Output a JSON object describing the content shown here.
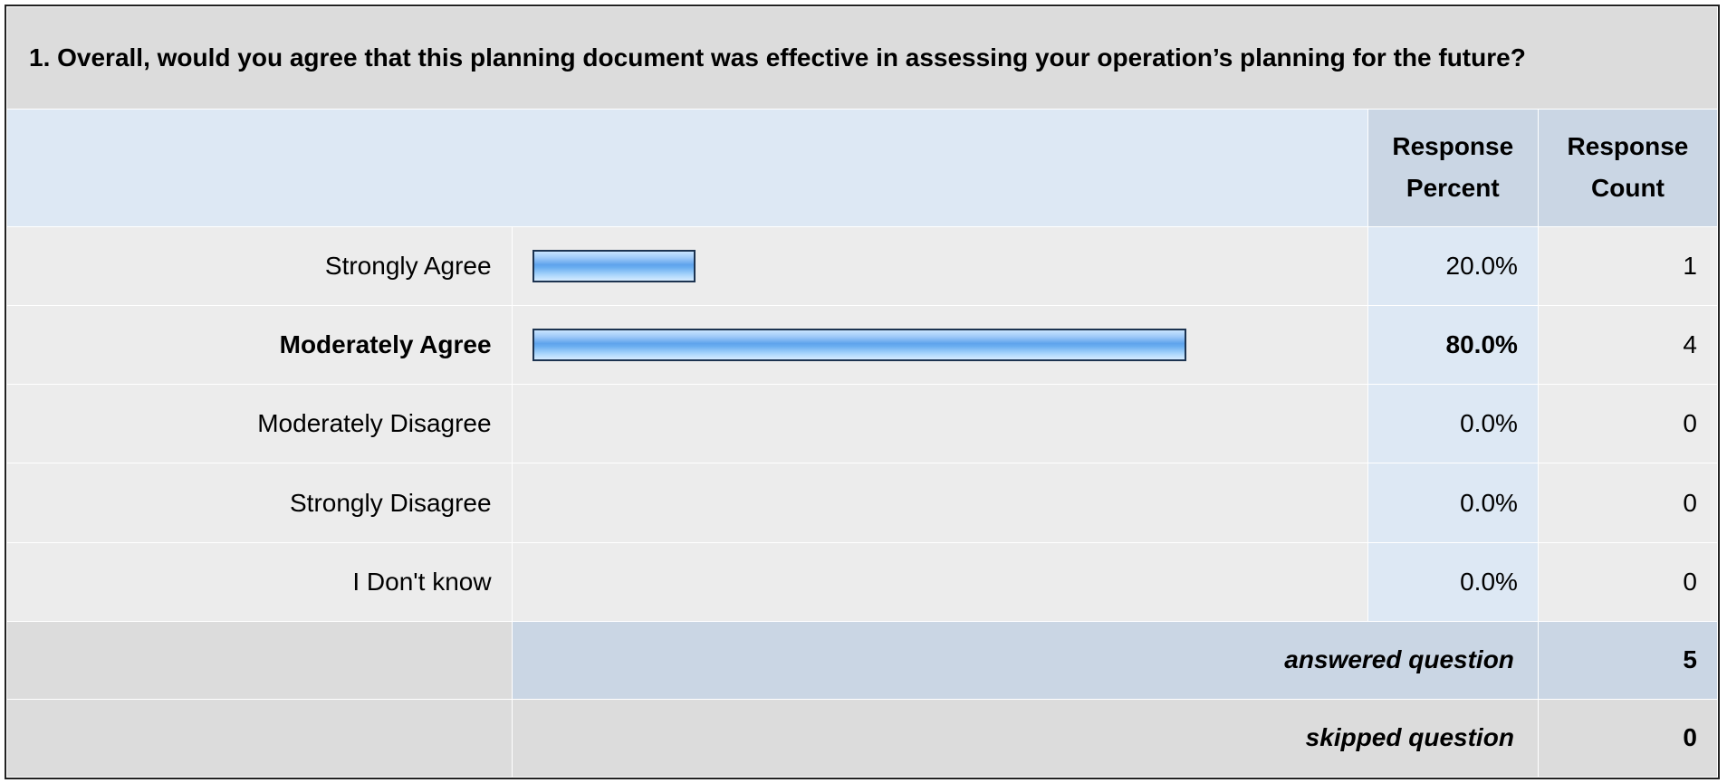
{
  "question": {
    "title": "1. Overall, would you agree that this planning document was effective in assessing your operation’s planning for the future?"
  },
  "headers": {
    "percent_line1": "Response",
    "percent_line2": "Percent",
    "count_line1": "Response",
    "count_line2": "Count"
  },
  "rows": [
    {
      "label": "Strongly Agree",
      "percent": "20.0%",
      "count": "1",
      "bold": false
    },
    {
      "label": "Moderately Agree",
      "percent": "80.0%",
      "count": "4",
      "bold": true
    },
    {
      "label": "Moderately Disagree",
      "percent": "0.0%",
      "count": "0",
      "bold": false
    },
    {
      "label": "Strongly Disagree",
      "percent": "0.0%",
      "count": "0",
      "bold": false
    },
    {
      "label": "I Don't know",
      "percent": "0.0%",
      "count": "0",
      "bold": false
    }
  ],
  "summary": {
    "answered_label": "answered question",
    "answered_value": "5",
    "skipped_label": "skipped question",
    "skipped_value": "0"
  },
  "colors": {
    "bar_fill": "#6aaef0",
    "bar_border": "#1c3350",
    "title_bg": "#dcdcdc",
    "header_bg": "#cad6e4",
    "light_blue_bg": "#dde8f4",
    "row_bg": "#ececec"
  },
  "chart_data": {
    "type": "bar",
    "orientation": "horizontal",
    "categories": [
      "Strongly Agree",
      "Moderately Agree",
      "Moderately Disagree",
      "Strongly Disagree",
      "I Don't know"
    ],
    "values": [
      20.0,
      80.0,
      0.0,
      0.0,
      0.0
    ],
    "counts": [
      1,
      4,
      0,
      0,
      0
    ],
    "title": "1. Overall, would you agree that this planning document was effective in assessing your operation’s planning for the future?",
    "xlim": [
      0,
      100
    ],
    "grid": false
  }
}
